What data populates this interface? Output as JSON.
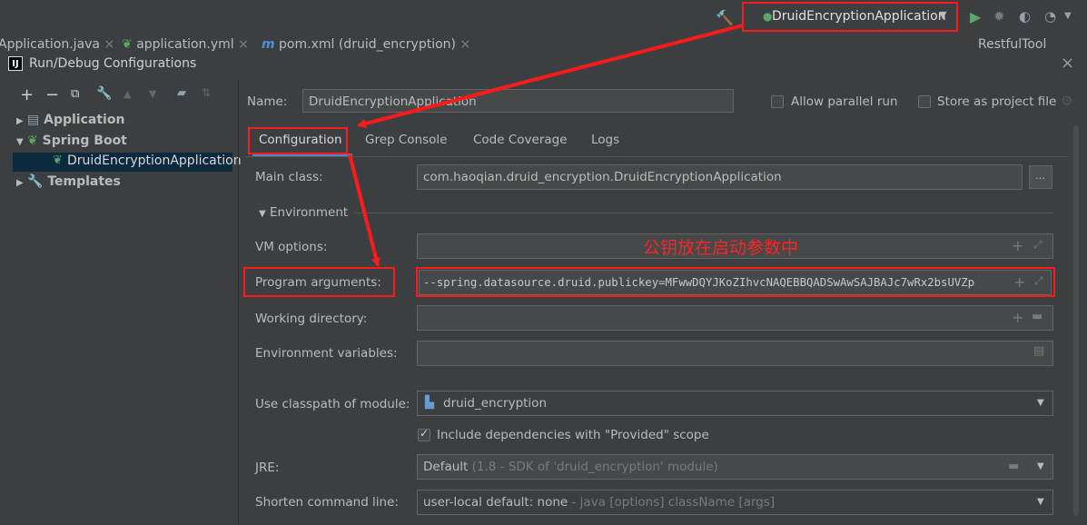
{
  "toolbar": {
    "run_config_label": "DruidEncryptionApplication"
  },
  "editor_tabs": [
    {
      "label": "Application.java"
    },
    {
      "label": "application.yml"
    },
    {
      "label": "pom.xml (druid_encryption)"
    },
    {
      "label": "RestfulTool"
    }
  ],
  "dialog": {
    "title": "Run/Debug Configurations",
    "tree": {
      "application": "Application",
      "spring_boot": "Spring Boot",
      "selected_config": "DruidEncryptionApplication",
      "templates": "Templates"
    },
    "name_label": "Name:",
    "name_value": "DruidEncryptionApplication",
    "allow_parallel_run": "Allow parallel run",
    "store_as_project_file": "Store as project file",
    "tabs": [
      {
        "label": "Configuration"
      },
      {
        "label": "Grep Console"
      },
      {
        "label": "Code Coverage"
      },
      {
        "label": "Logs"
      }
    ],
    "main_class_label": "Main class:",
    "main_class_value": "com.haoqian.druid_encryption.DruidEncryptionApplication",
    "environment_label": "Environment",
    "vm_options_label": "VM options:",
    "annotation": "公钥放在启动参数中",
    "program_args_label": "Program arguments:",
    "program_args_value": "--spring.datasource.druid.publickey=MFwwDQYJKoZIhvcNAQEBBQADSwAwSAJBAJc7wRx2bsUVZp",
    "working_dir_label": "Working directory:",
    "env_vars_label": "Environment variables:",
    "classpath_label": "Use classpath of module:",
    "classpath_value": "druid_encryption",
    "include_deps": "Include dependencies with \"Provided\" scope",
    "jre_label": "JRE:",
    "jre_value": "Default",
    "jre_detail": "(1.8 - SDK of 'druid_encryption' module)",
    "shorten_label": "Shorten command line:",
    "shorten_value": "user-local default: none",
    "shorten_detail": "- java [options] className [args]"
  },
  "colors": {
    "accent_red": "#ff1a1a",
    "run_green": "#59a869",
    "selected_row": "#0d293e"
  }
}
